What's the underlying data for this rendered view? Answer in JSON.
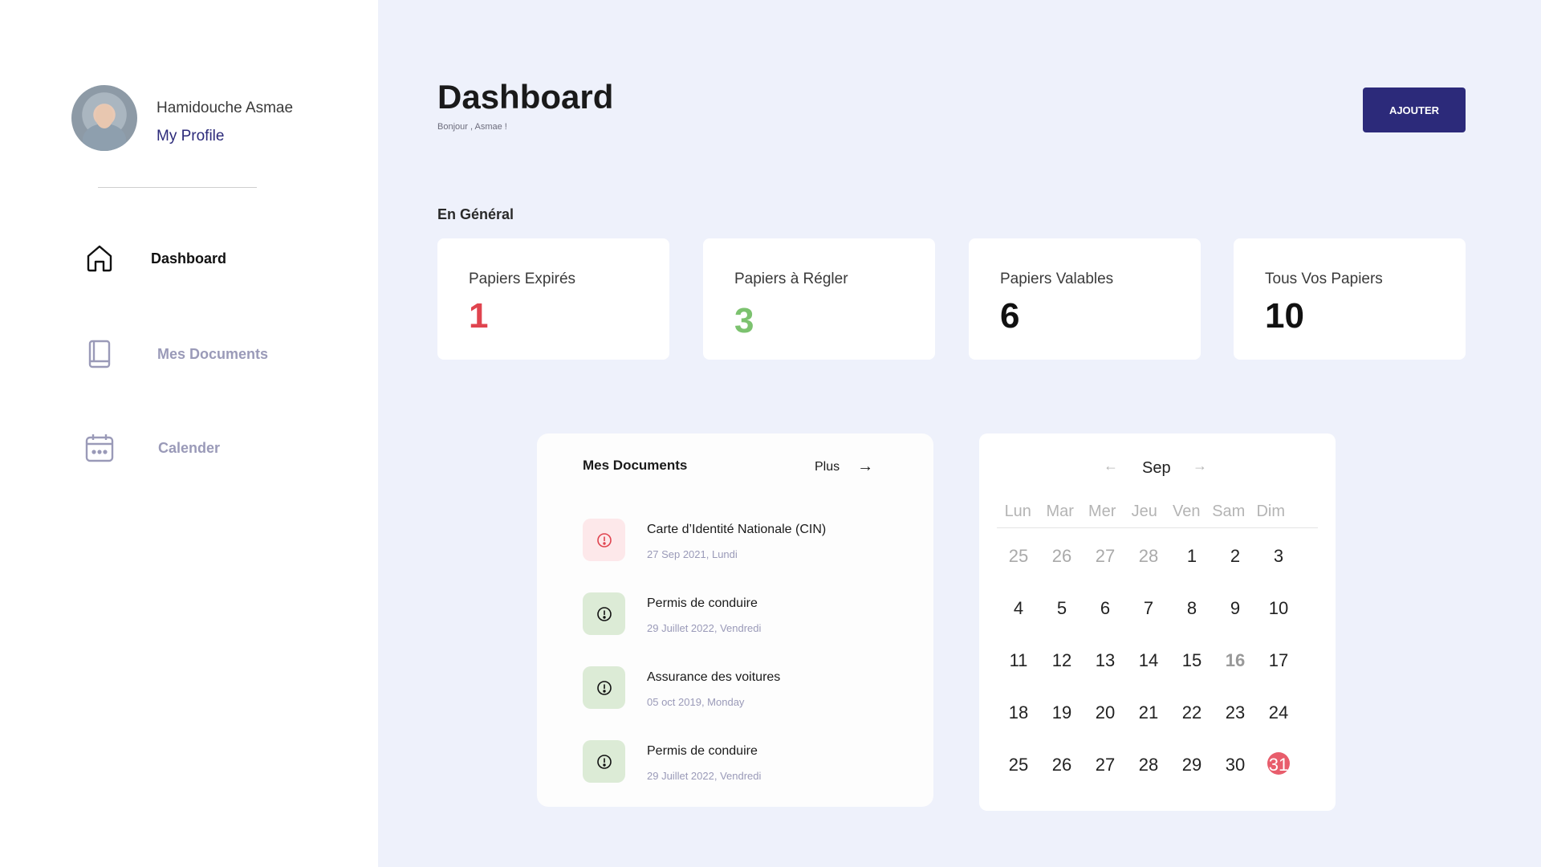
{
  "sidebar": {
    "user_name": "Hamidouche Asmae",
    "profile_link": "My Profile",
    "items": [
      {
        "label": "Dashboard",
        "icon": "home-icon"
      },
      {
        "label": "Mes Documents",
        "icon": "book-icon"
      },
      {
        "label": "Calender",
        "icon": "calendar-icon"
      }
    ]
  },
  "header": {
    "title": "Dashboard",
    "greeting": "Bonjour , Asmae !",
    "add_button": "AJOUTER"
  },
  "overview": {
    "section_title": "En Général",
    "cards": [
      {
        "label": "Papiers Expirés",
        "value": "1",
        "color": "#e0444f"
      },
      {
        "label": "Papiers à Régler",
        "value": "3",
        "color": "#7cc26f"
      },
      {
        "label": "Papiers Valables",
        "value": "6",
        "color": "#111111"
      },
      {
        "label": "Tous Vos Papiers",
        "value": "10",
        "color": "#111111"
      }
    ]
  },
  "documents": {
    "title": "Mes Documents",
    "more_label": "Plus",
    "items": [
      {
        "name": "Carte d’Identité Nationale (CIN)",
        "date": "27 Sep 2021, Lundi",
        "status": "expired",
        "icon": "alert-circle-icon"
      },
      {
        "name": "Permis de conduire",
        "date": "29 Juillet 2022, Vendredi",
        "status": "valid",
        "icon": "alert-circle-icon"
      },
      {
        "name": "Assurance des voitures",
        "date": "05 oct 2019, Monday",
        "status": "valid",
        "icon": "alert-circle-icon"
      },
      {
        "name": "Permis de conduire",
        "date": "29 Juillet 2022, Vendredi",
        "status": "valid",
        "icon": "alert-circle-icon"
      }
    ]
  },
  "calendar": {
    "month": "Sep",
    "weekdays": [
      "Lun",
      "Mar",
      "Mer",
      "Jeu",
      "Ven",
      "Sam",
      "Dim"
    ],
    "weeks": [
      [
        "25",
        "26",
        "27",
        "28",
        "1",
        "2",
        "3"
      ],
      [
        "4",
        "5",
        "6",
        "7",
        "8",
        "9",
        "10"
      ],
      [
        "11",
        "12",
        "13",
        "14",
        "15",
        "16",
        "17"
      ],
      [
        "18",
        "19",
        "20",
        "21",
        "22",
        "23",
        "24"
      ],
      [
        "25",
        "26",
        "27",
        "28",
        "29",
        "30",
        "31"
      ]
    ],
    "today": "31",
    "highlight_color": "#e85d6c"
  },
  "colors": {
    "accent": "#2c2a7a",
    "background": "#eef1fb",
    "expired": "#e0444f",
    "pending": "#7cc26f"
  }
}
